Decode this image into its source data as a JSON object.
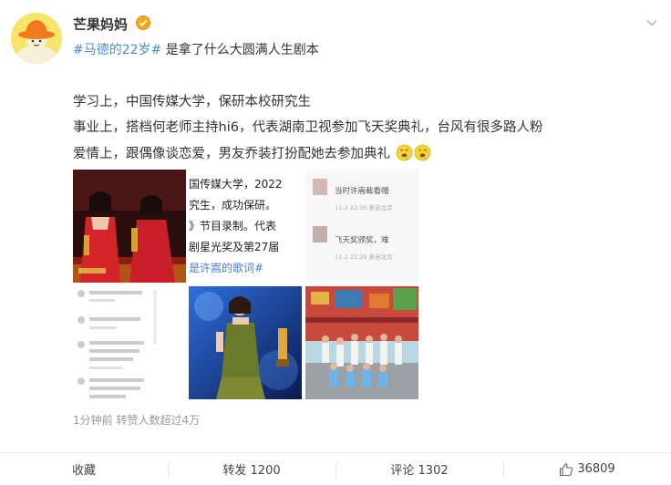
{
  "post": {
    "username": "芒果妈妈",
    "hashtag": "#马德的22岁#",
    "first_line_rest": " 是拿了什么大圆满人生剧本",
    "lines": [
      "学习上，中国传媒大学，保研本校研究生",
      "事业上，搭档何老师主持hi6，代表湖南卫视参加飞天奖典礼，台风有很多路人粉",
      "爱情上，跟偶像谈恋爱，男友乔装打扮配她去参加典礼"
    ],
    "meta": "1分钟前  转赞人数超过4万"
  },
  "thumbnails": {
    "t2_lines": [
      "国传媒大学，2022",
      "究生，成功保研。",
      "》节目录制。代表",
      "剧星光奖及第27届",
      "是许嵩的歌词#"
    ],
    "t3_lines": [
      "当时许嵩截看帽",
      "11-2 22:30  来自北京",
      "飞天奖颁奖，难",
      "11-2 22:29  来自北京"
    ]
  },
  "actions": {
    "collect": "收藏",
    "repost": "转发 1200",
    "comment": "评论 1302",
    "like": "36809"
  },
  "icons": {
    "verified": "verified-badge-icon",
    "more": "chevron-down-icon",
    "like": "thumbs-up-icon",
    "emoji": "drooling-face-emoji-icon"
  },
  "colors": {
    "hashtag": "#4a8fd4",
    "verified": "#f7a71b",
    "meta": "#999999"
  }
}
